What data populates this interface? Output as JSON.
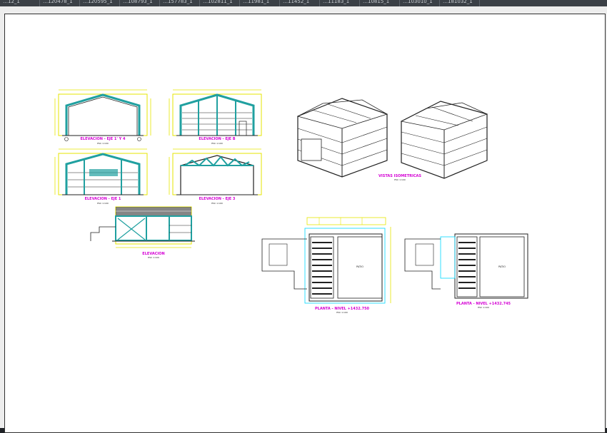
{
  "window": {
    "tabs": [
      "…12_1",
      "…120478_1",
      "…120595_1",
      "…108793_1",
      "…157783_1",
      "…102811_1",
      "…11981_1",
      "…11452_1",
      "…11183_1",
      "…10815_1",
      "…103010_1",
      "…181032_1"
    ]
  },
  "drawing": {
    "views": {
      "elevation_a": {
        "title": "ELEVACION - EJE 1' Y 4",
        "scale": "ESC 1:100"
      },
      "elevation_b": {
        "title": "ELEVACION - EJE B",
        "scale": "ESC 1:100"
      },
      "elevation_c": {
        "title": "ELEVACION - EJE 1",
        "scale": "ESC 1:100"
      },
      "elevation_d": {
        "title": "ELEVACION - EJE 3",
        "scale": "ESC 1:100"
      },
      "elevation_e": {
        "title": "ELEVACION",
        "scale": "ESC 1:100"
      },
      "isometric": {
        "title": "VISTAS ISOMETRICAS",
        "scale": "ESC 1:100"
      },
      "plan_1": {
        "title": "PLANTA - NIVEL +1432.750",
        "scale": "ESC 1:100",
        "room": "PATIO"
      },
      "plan_2": {
        "title": "PLANTA - NIVEL +1432.745",
        "scale": "ESC 1:100",
        "room": "PATIO"
      }
    }
  },
  "colors": {
    "dimension": "#e6e600",
    "structure": "#20a0a0",
    "label": "#d400d4",
    "grid": "#00d8ff",
    "line": "#202020"
  }
}
